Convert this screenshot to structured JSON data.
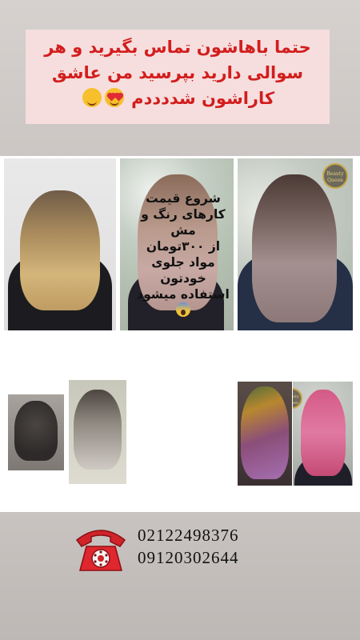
{
  "banner": {
    "lines": [
      "حتما باهاشون تماس بگیرید و هر",
      "سوالی دارید بپرسید من عاشق",
      "کاراشون شددددم"
    ],
    "emojis": [
      "smiling-face-with-heart-eyes-icon",
      "smiling-face-with-hearts-icon"
    ],
    "text_color": "#d31d1d",
    "background_color": "#f6dede"
  },
  "logo": {
    "text_line1": "Beauty",
    "text_line2": "Queen"
  },
  "price_info": {
    "lines": [
      "شروع قیمت",
      "کارهای رنگ و",
      "مش",
      "از ۳۰۰تومان",
      "مواد جلوی",
      "خودتون",
      "استفاده میشود"
    ],
    "emoji": "face-screaming-in-fear-icon"
  },
  "contact": {
    "phone_1": "02122498376",
    "phone_2": "09120302644",
    "icon": "red-telephone-icon"
  }
}
